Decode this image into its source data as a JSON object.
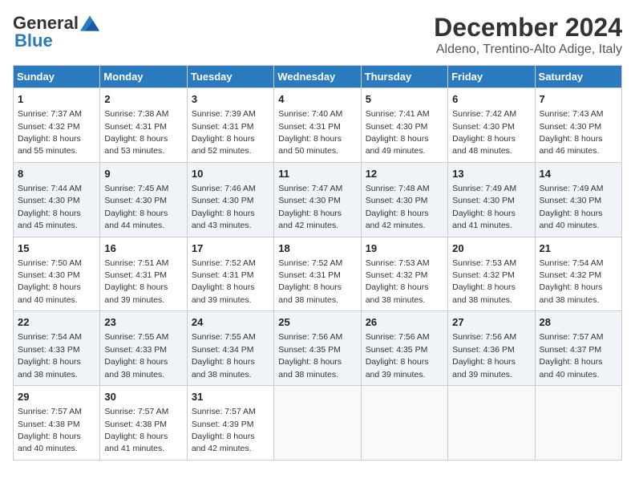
{
  "header": {
    "logo_general": "General",
    "logo_blue": "Blue",
    "main_title": "December 2024",
    "subtitle": "Aldeno, Trentino-Alto Adige, Italy"
  },
  "calendar": {
    "days_of_week": [
      "Sunday",
      "Monday",
      "Tuesday",
      "Wednesday",
      "Thursday",
      "Friday",
      "Saturday"
    ],
    "weeks": [
      [
        null,
        null,
        null,
        null,
        null,
        null,
        null
      ]
    ]
  },
  "cells": [
    {
      "day": "1",
      "sunrise": "Sunrise: 7:37 AM",
      "sunset": "Sunset: 4:32 PM",
      "daylight": "Daylight: 8 hours and 55 minutes."
    },
    {
      "day": "2",
      "sunrise": "Sunrise: 7:38 AM",
      "sunset": "Sunset: 4:31 PM",
      "daylight": "Daylight: 8 hours and 53 minutes."
    },
    {
      "day": "3",
      "sunrise": "Sunrise: 7:39 AM",
      "sunset": "Sunset: 4:31 PM",
      "daylight": "Daylight: 8 hours and 52 minutes."
    },
    {
      "day": "4",
      "sunrise": "Sunrise: 7:40 AM",
      "sunset": "Sunset: 4:31 PM",
      "daylight": "Daylight: 8 hours and 50 minutes."
    },
    {
      "day": "5",
      "sunrise": "Sunrise: 7:41 AM",
      "sunset": "Sunset: 4:30 PM",
      "daylight": "Daylight: 8 hours and 49 minutes."
    },
    {
      "day": "6",
      "sunrise": "Sunrise: 7:42 AM",
      "sunset": "Sunset: 4:30 PM",
      "daylight": "Daylight: 8 hours and 48 minutes."
    },
    {
      "day": "7",
      "sunrise": "Sunrise: 7:43 AM",
      "sunset": "Sunset: 4:30 PM",
      "daylight": "Daylight: 8 hours and 46 minutes."
    },
    {
      "day": "8",
      "sunrise": "Sunrise: 7:44 AM",
      "sunset": "Sunset: 4:30 PM",
      "daylight": "Daylight: 8 hours and 45 minutes."
    },
    {
      "day": "9",
      "sunrise": "Sunrise: 7:45 AM",
      "sunset": "Sunset: 4:30 PM",
      "daylight": "Daylight: 8 hours and 44 minutes."
    },
    {
      "day": "10",
      "sunrise": "Sunrise: 7:46 AM",
      "sunset": "Sunset: 4:30 PM",
      "daylight": "Daylight: 8 hours and 43 minutes."
    },
    {
      "day": "11",
      "sunrise": "Sunrise: 7:47 AM",
      "sunset": "Sunset: 4:30 PM",
      "daylight": "Daylight: 8 hours and 42 minutes."
    },
    {
      "day": "12",
      "sunrise": "Sunrise: 7:48 AM",
      "sunset": "Sunset: 4:30 PM",
      "daylight": "Daylight: 8 hours and 42 minutes."
    },
    {
      "day": "13",
      "sunrise": "Sunrise: 7:49 AM",
      "sunset": "Sunset: 4:30 PM",
      "daylight": "Daylight: 8 hours and 41 minutes."
    },
    {
      "day": "14",
      "sunrise": "Sunrise: 7:49 AM",
      "sunset": "Sunset: 4:30 PM",
      "daylight": "Daylight: 8 hours and 40 minutes."
    },
    {
      "day": "15",
      "sunrise": "Sunrise: 7:50 AM",
      "sunset": "Sunset: 4:30 PM",
      "daylight": "Daylight: 8 hours and 40 minutes."
    },
    {
      "day": "16",
      "sunrise": "Sunrise: 7:51 AM",
      "sunset": "Sunset: 4:31 PM",
      "daylight": "Daylight: 8 hours and 39 minutes."
    },
    {
      "day": "17",
      "sunrise": "Sunrise: 7:52 AM",
      "sunset": "Sunset: 4:31 PM",
      "daylight": "Daylight: 8 hours and 39 minutes."
    },
    {
      "day": "18",
      "sunrise": "Sunrise: 7:52 AM",
      "sunset": "Sunset: 4:31 PM",
      "daylight": "Daylight: 8 hours and 38 minutes."
    },
    {
      "day": "19",
      "sunrise": "Sunrise: 7:53 AM",
      "sunset": "Sunset: 4:32 PM",
      "daylight": "Daylight: 8 hours and 38 minutes."
    },
    {
      "day": "20",
      "sunrise": "Sunrise: 7:53 AM",
      "sunset": "Sunset: 4:32 PM",
      "daylight": "Daylight: 8 hours and 38 minutes."
    },
    {
      "day": "21",
      "sunrise": "Sunrise: 7:54 AM",
      "sunset": "Sunset: 4:32 PM",
      "daylight": "Daylight: 8 hours and 38 minutes."
    },
    {
      "day": "22",
      "sunrise": "Sunrise: 7:54 AM",
      "sunset": "Sunset: 4:33 PM",
      "daylight": "Daylight: 8 hours and 38 minutes."
    },
    {
      "day": "23",
      "sunrise": "Sunrise: 7:55 AM",
      "sunset": "Sunset: 4:33 PM",
      "daylight": "Daylight: 8 hours and 38 minutes."
    },
    {
      "day": "24",
      "sunrise": "Sunrise: 7:55 AM",
      "sunset": "Sunset: 4:34 PM",
      "daylight": "Daylight: 8 hours and 38 minutes."
    },
    {
      "day": "25",
      "sunrise": "Sunrise: 7:56 AM",
      "sunset": "Sunset: 4:35 PM",
      "daylight": "Daylight: 8 hours and 38 minutes."
    },
    {
      "day": "26",
      "sunrise": "Sunrise: 7:56 AM",
      "sunset": "Sunset: 4:35 PM",
      "daylight": "Daylight: 8 hours and 39 minutes."
    },
    {
      "day": "27",
      "sunrise": "Sunrise: 7:56 AM",
      "sunset": "Sunset: 4:36 PM",
      "daylight": "Daylight: 8 hours and 39 minutes."
    },
    {
      "day": "28",
      "sunrise": "Sunrise: 7:57 AM",
      "sunset": "Sunset: 4:37 PM",
      "daylight": "Daylight: 8 hours and 40 minutes."
    },
    {
      "day": "29",
      "sunrise": "Sunrise: 7:57 AM",
      "sunset": "Sunset: 4:38 PM",
      "daylight": "Daylight: 8 hours and 40 minutes."
    },
    {
      "day": "30",
      "sunrise": "Sunrise: 7:57 AM",
      "sunset": "Sunset: 4:38 PM",
      "daylight": "Daylight: 8 hours and 41 minutes."
    },
    {
      "day": "31",
      "sunrise": "Sunrise: 7:57 AM",
      "sunset": "Sunset: 4:39 PM",
      "daylight": "Daylight: 8 hours and 42 minutes."
    }
  ]
}
